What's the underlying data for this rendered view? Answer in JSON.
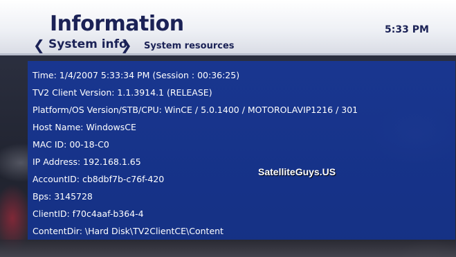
{
  "header": {
    "title": "Information",
    "clock": "5:33 PM"
  },
  "tabs": [
    {
      "label": "System info",
      "active": true
    },
    {
      "label": "System resources",
      "active": false
    }
  ],
  "icons": {
    "prev": "chevron-left-icon",
    "next": "chevron-right-icon"
  },
  "info": {
    "rows": [
      "Time: 1/4/2007 5:33:34 PM (Session : 00:36:25)",
      "TV2 Client Version: 1.1.3914.1 (RELEASE)",
      "Platform/OS Version/STB/CPU: WinCE / 5.0.1400 / MOTOROLAVIP1216 / 301",
      "Host Name: WindowsCE",
      "MAC ID: 00-18-C0",
      "IP Address: 192.168.1.65",
      "AccountID: cb8dbf7b-c76f-420",
      "Bps: 3145728",
      "ClientID: f70c4aaf-b364-4",
      "ContentDir: \\Hard Disk\\TV2ClientCE\\Content"
    ]
  },
  "watermark": "SatelliteGuys.US",
  "colors": {
    "accent": "#1b2256",
    "panel": "#1a3a96",
    "text": "#ffffff"
  }
}
